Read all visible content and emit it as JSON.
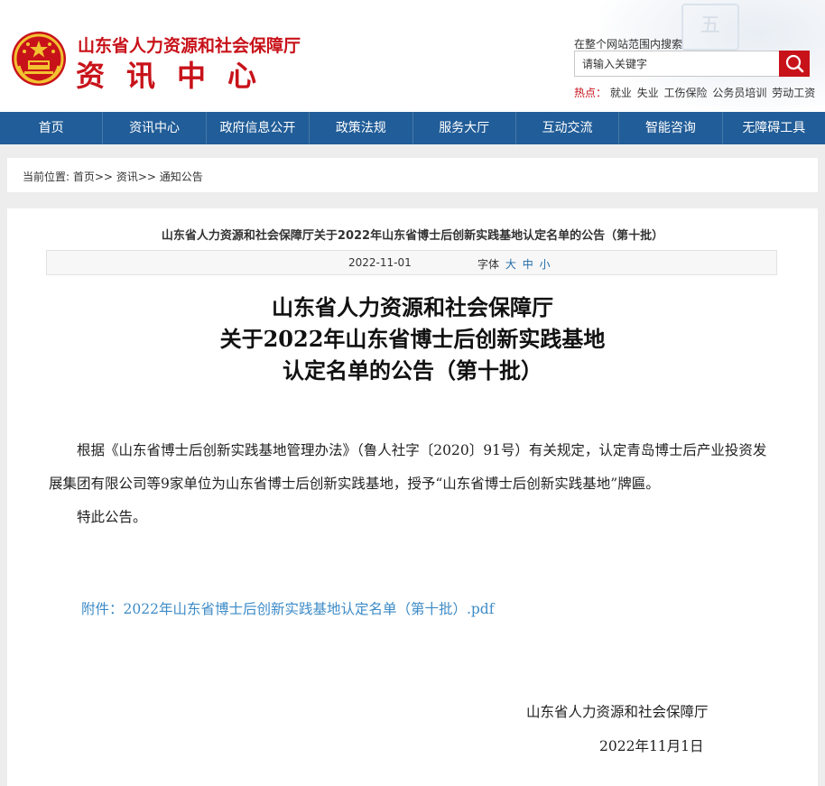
{
  "header": {
    "org_name": "山东省人力资源和社会保障厅",
    "site_name": "资讯中心",
    "search_hint": "在整个网站范围内搜索",
    "search_value": "请输入关键字",
    "hot_label": "热点：",
    "hot_links": [
      "就业",
      "失业",
      "工伤保险",
      "公务员培训",
      "劳动工资"
    ],
    "deco_char": "五"
  },
  "nav": [
    "首页",
    "资讯中心",
    "政府信息公开",
    "政策法规",
    "服务大厅",
    "互动交流",
    "智能咨询",
    "无障碍工具"
  ],
  "breadcrumb": {
    "prefix": "当前位置: ",
    "items": [
      "首页",
      "资讯",
      "通知公告"
    ],
    "sep": ">>"
  },
  "article": {
    "header_title": "山东省人力资源和社会保障厅关于2022年山东省博士后创新实践基地认定名单的公告（第十批）",
    "date": "2022-11-01",
    "font_label": "字体",
    "font_sizes": [
      "大",
      "中",
      "小"
    ],
    "title_lines": [
      "山东省人力资源和社会保障厅",
      "关于2022年山东省博士后创新实践基地",
      "认定名单的公告（第十批）"
    ],
    "paragraphs": [
      "根据《山东省博士后创新实践基地管理办法》（鲁人社字〔2020〕91号）有关规定，认定青岛博士后产业投资发展集团有限公司等9家单位为山东省博士后创新实践基地，授予“山东省博士后创新实践基地”牌匾。",
      "特此公告。"
    ],
    "attachment": "附件：2022年山东省博士后创新实践基地认定名单（第十批）.pdf",
    "signature_org": "山东省人力资源和社会保障厅",
    "signature_date": "2022年11月1日"
  },
  "colors": {
    "brand_red": "#c8121a",
    "nav_blue": "#215d98",
    "link_blue": "#3d8bc7"
  }
}
